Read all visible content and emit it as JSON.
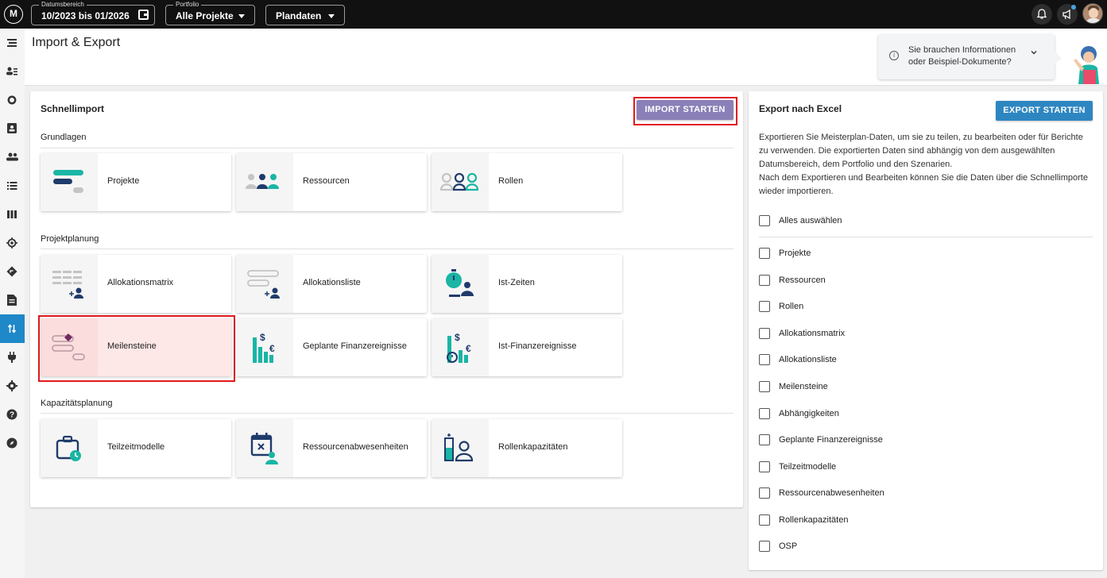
{
  "topbar": {
    "logo_text": "M",
    "date_range": {
      "label": "Datumsbereich",
      "value": "10/2023 bis 01/2026"
    },
    "portfolio": {
      "label": "Portfolio",
      "value": "Alle Projekte"
    },
    "scenario": {
      "value": "Plandaten"
    }
  },
  "nav": {
    "items": [
      "menu",
      "people-list",
      "chart",
      "person-card",
      "group",
      "list",
      "columns",
      "target",
      "diamond",
      "document",
      "import-export",
      "plug",
      "settings",
      "help",
      "compass"
    ],
    "active_index": 10
  },
  "header": {
    "title": "Import & Export",
    "info_text": "Sie brauchen Informationen oder Beispiel-Dokumente?"
  },
  "schnellimport": {
    "title": "Schnellimport",
    "button": "IMPORT STARTEN",
    "sections": [
      {
        "label": "Grundlagen",
        "tiles": [
          "Projekte",
          "Ressourcen",
          "Rollen"
        ]
      },
      {
        "label": "Projektplanung",
        "tiles": [
          "Allokationsmatrix",
          "Allokationsliste",
          "Ist-Zeiten",
          "Meilensteine",
          "Geplante Finanzereignisse",
          "Ist-Finanzereignisse"
        ]
      },
      {
        "label": "Kapazitätsplanung",
        "tiles": [
          "Teilzeitmodelle",
          "Ressourcenabwesenheiten",
          "Rollenkapazitäten"
        ]
      }
    ],
    "highlighted_tile": "Meilensteine"
  },
  "export": {
    "title": "Export nach Excel",
    "button": "EXPORT STARTEN",
    "desc_1": "Exportieren Sie Meisterplan-Daten, um sie zu teilen, zu bearbeiten oder für Berichte zu verwenden. Die exportierten Daten sind abhängig von dem ausgewählten Datumsbereich, dem Portfolio und den Szenarien.",
    "desc_2": "Nach dem Exportieren und Bearbeiten können Sie die Daten über die Schnellimporte wieder importieren.",
    "select_all": "Alles auswählen",
    "items": [
      "Projekte",
      "Ressourcen",
      "Rollen",
      "Allokationsmatrix",
      "Allokationsliste",
      "Meilensteine",
      "Abhängigkeiten",
      "Geplante Finanzereignisse",
      "Teilzeitmodelle",
      "Ressourcenabwesenheiten",
      "Rollenkapazitäten",
      "OSP"
    ]
  },
  "colors": {
    "teal": "#1ab5a5",
    "navy": "#1f3b6b",
    "grey": "#c4c4c4",
    "purple": "#8a80b7",
    "blue": "#2e86c1",
    "highlight_red": "#e1191d"
  }
}
